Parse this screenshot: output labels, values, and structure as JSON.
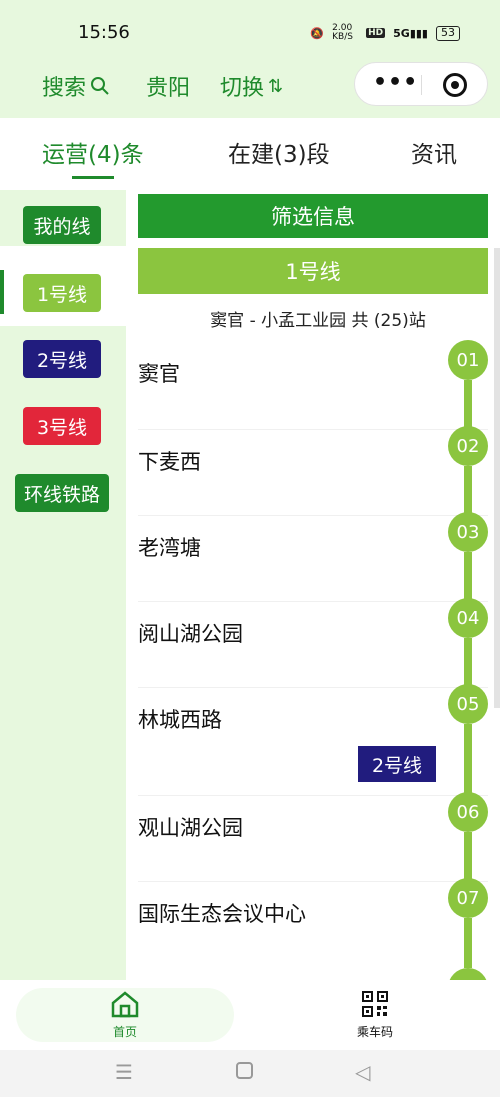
{
  "status_bar": {
    "time": "15:56",
    "net_speed": "2.00 KB/S",
    "hd": "HD",
    "signal": "5G",
    "battery": "53"
  },
  "top_nav": {
    "search_label": "搜索",
    "city": "贵阳",
    "switch_label": "切换"
  },
  "tabs": [
    {
      "label": "运营(4)条"
    },
    {
      "label": "在建(3)段"
    },
    {
      "label": "资讯"
    }
  ],
  "sidebar": {
    "items": [
      {
        "label": "我的线",
        "color": "#1f8a2c"
      },
      {
        "label": "1号线",
        "color": "#8bc53f"
      },
      {
        "label": "2号线",
        "color": "#211c7e"
      },
      {
        "label": "3号线",
        "color": "#e2263a"
      },
      {
        "label": "环线铁路",
        "color": "#1f8a2c"
      }
    ]
  },
  "main": {
    "filter_label": "筛选信息",
    "line_name": "1号线",
    "route_info": "窦官 - 小孟工业园 共 (25)站",
    "stations": [
      {
        "name": "窦官",
        "num": "01"
      },
      {
        "name": "下麦西",
        "num": "02"
      },
      {
        "name": "老湾塘",
        "num": "03"
      },
      {
        "name": "阅山湖公园",
        "num": "04"
      },
      {
        "name": "林城西路",
        "num": "05",
        "transfer": "2号线"
      },
      {
        "name": "观山湖公园",
        "num": "06"
      },
      {
        "name": "国际生态会议中心",
        "num": "07"
      }
    ]
  },
  "bottom_nav": {
    "home_label": "首页",
    "qr_label": "乘车码"
  },
  "colors": {
    "brand_green": "#1f8a2c",
    "line1_green": "#8bc53f",
    "line2_navy": "#211c7e",
    "line3_red": "#e2263a"
  }
}
